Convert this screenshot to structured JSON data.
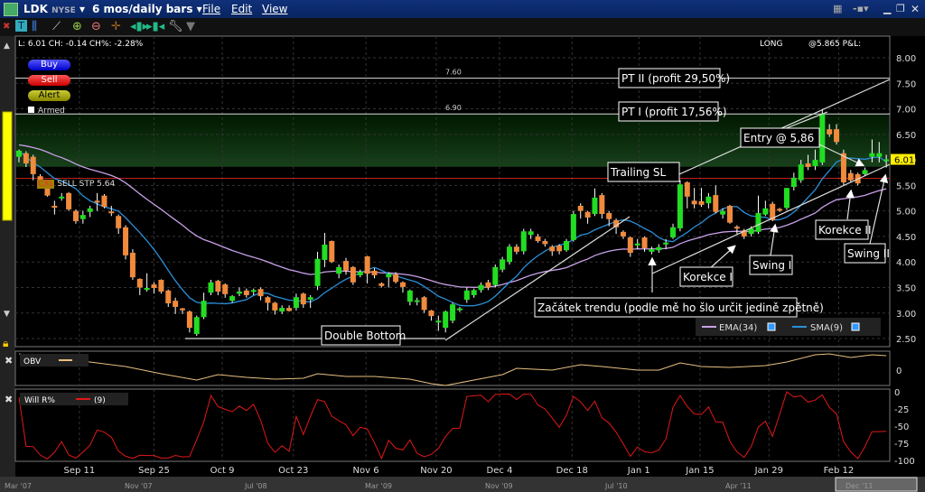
{
  "window": {
    "symbol": "LDK",
    "exchange": "NYSE",
    "period": "6 mos/daily bars",
    "menu": [
      "File",
      "Edit",
      "View"
    ]
  },
  "info": {
    "quote": "L: 6.01 CH: -0.14 CH%: -2.28%",
    "position": "LONG",
    "pnl": "@5.865 P&L:"
  },
  "order_buttons": {
    "buy": "Buy",
    "sell": "Sell",
    "alert": "Alert",
    "armed": "Armed"
  },
  "order_tag": {
    "cancel": "CXL",
    "text": "SELL STP 5.64"
  },
  "colors": {
    "up": "#22dd22",
    "down": "#f08a3c",
    "ema": "#c8a0e8",
    "sma": "#2a8fd8",
    "obv": "#e8c080",
    "willr": "#e01818",
    "stop": "#c02020",
    "last": "#ffee00"
  },
  "chart_data": [
    {
      "type": "candlestick",
      "ylim": [
        2.35,
        8.25
      ],
      "y_ticks": [
        "8.00",
        "7.50",
        "7.00",
        "6.50",
        "6.00",
        "5.50",
        "5.00",
        "4.50",
        "4.00",
        "3.50",
        "3.00",
        "2.50"
      ],
      "last_price": "6.01",
      "x_labels": [
        {
          "label": "Sep 11",
          "bar": 8.5
        },
        {
          "label": "Sep 25",
          "bar": 19
        },
        {
          "label": "Oct 9",
          "bar": 28.6
        },
        {
          "label": "Oct 23",
          "bar": 38.6
        },
        {
          "label": "Nov 6",
          "bar": 48.8
        },
        {
          "label": "Nov 20",
          "bar": 58.7
        },
        {
          "label": "Dec 4",
          "bar": 67.6
        },
        {
          "label": "Dec 18",
          "bar": 77.8
        },
        {
          "label": "Jan 1",
          "bar": 87.2
        },
        {
          "label": "Jan 15",
          "bar": 95.8
        },
        {
          "label": "Jan 29",
          "bar": 105.5
        },
        {
          "label": "Feb 12",
          "bar": 115.3
        }
      ],
      "ohlc": [
        [
          6.06,
          6.2,
          5.95,
          6.18
        ],
        [
          6.13,
          6.17,
          5.86,
          5.93
        ],
        [
          6.06,
          6.1,
          5.6,
          5.72
        ],
        [
          5.68,
          5.72,
          5.55,
          5.6
        ],
        [
          5.5,
          5.55,
          5.28,
          5.3
        ],
        [
          5.1,
          5.2,
          4.93,
          5.08
        ],
        [
          5.25,
          5.35,
          5.2,
          5.28
        ],
        [
          5.35,
          5.37,
          5.0,
          5.03
        ],
        [
          5.0,
          5.03,
          4.75,
          4.8
        ],
        [
          4.84,
          5.0,
          4.75,
          4.92
        ],
        [
          4.98,
          5.1,
          4.88,
          5.05
        ],
        [
          5.2,
          5.35,
          5.0,
          5.18
        ],
        [
          5.3,
          5.33,
          5.05,
          5.08
        ],
        [
          4.99,
          5.1,
          4.9,
          4.96
        ],
        [
          4.9,
          4.93,
          4.55,
          4.66
        ],
        [
          4.68,
          4.72,
          4.05,
          4.13
        ],
        [
          4.18,
          4.25,
          3.65,
          3.7
        ],
        [
          3.67,
          3.68,
          3.35,
          3.5
        ],
        [
          3.47,
          3.78,
          3.42,
          3.49
        ],
        [
          3.56,
          3.6,
          3.38,
          3.49
        ],
        [
          3.65,
          3.66,
          3.38,
          3.42
        ],
        [
          3.44,
          3.46,
          3.12,
          3.19
        ],
        [
          3.24,
          3.3,
          2.98,
          3.12
        ],
        [
          3.09,
          3.1,
          2.98,
          3.07
        ],
        [
          3.03,
          3.05,
          2.62,
          2.71
        ],
        [
          2.59,
          2.95,
          2.55,
          2.92
        ],
        [
          2.92,
          3.4,
          2.88,
          3.24
        ],
        [
          3.4,
          3.65,
          3.35,
          3.6
        ],
        [
          3.63,
          3.65,
          3.35,
          3.42
        ],
        [
          3.56,
          3.58,
          3.3,
          3.37
        ],
        [
          3.24,
          3.35,
          3.2,
          3.33
        ],
        [
          3.38,
          3.5,
          3.33,
          3.42
        ],
        [
          3.44,
          3.48,
          3.3,
          3.35
        ],
        [
          3.42,
          3.48,
          3.35,
          3.45
        ],
        [
          3.47,
          3.5,
          3.25,
          3.33
        ],
        [
          3.31,
          3.33,
          3.05,
          3.2
        ],
        [
          3.2,
          3.22,
          2.97,
          3.05
        ],
        [
          3.03,
          3.15,
          2.98,
          3.1
        ],
        [
          3.1,
          3.15,
          3.03,
          3.04
        ],
        [
          3.1,
          3.38,
          3.05,
          3.31
        ],
        [
          3.38,
          3.4,
          3.1,
          3.17
        ],
        [
          3.26,
          3.35,
          3.1,
          3.31
        ],
        [
          3.53,
          4.2,
          3.45,
          4.06
        ],
        [
          4.04,
          4.57,
          3.9,
          4.34
        ],
        [
          4.41,
          4.42,
          3.98,
          4.0
        ],
        [
          3.77,
          3.95,
          3.68,
          3.9
        ],
        [
          4.02,
          4.08,
          3.75,
          3.83
        ],
        [
          3.9,
          3.92,
          3.55,
          3.6
        ],
        [
          3.74,
          3.85,
          3.7,
          3.81
        ],
        [
          4.11,
          4.12,
          3.58,
          3.77
        ],
        [
          3.83,
          3.88,
          3.68,
          3.74
        ],
        [
          3.58,
          3.6,
          3.5,
          3.53
        ],
        [
          3.7,
          3.8,
          3.5,
          3.77
        ],
        [
          3.76,
          3.8,
          3.58,
          3.61
        ],
        [
          3.6,
          3.62,
          3.4,
          3.51
        ],
        [
          3.22,
          3.46,
          3.15,
          3.44
        ],
        [
          3.23,
          3.3,
          3.15,
          3.25
        ],
        [
          3.31,
          3.33,
          3.0,
          3.06
        ],
        [
          3.05,
          3.06,
          2.85,
          2.94
        ],
        [
          2.83,
          2.95,
          2.65,
          2.85
        ],
        [
          2.71,
          3.05,
          2.62,
          3.03
        ],
        [
          2.85,
          3.2,
          2.8,
          3.17
        ],
        [
          3.07,
          3.12,
          3.02,
          3.09
        ],
        [
          3.26,
          3.5,
          3.2,
          3.44
        ],
        [
          3.35,
          3.48,
          3.3,
          3.45
        ],
        [
          3.45,
          3.6,
          3.4,
          3.55
        ],
        [
          3.6,
          3.65,
          3.45,
          3.5
        ],
        [
          3.55,
          3.95,
          3.5,
          3.9
        ],
        [
          3.85,
          4.1,
          3.8,
          4.05
        ],
        [
          4.0,
          4.35,
          3.95,
          4.3
        ],
        [
          4.3,
          4.35,
          4.15,
          4.2
        ],
        [
          4.21,
          4.65,
          4.15,
          4.6
        ],
        [
          4.53,
          4.65,
          4.45,
          4.6
        ],
        [
          4.5,
          4.55,
          4.38,
          4.41
        ],
        [
          4.41,
          4.45,
          4.3,
          4.35
        ],
        [
          4.3,
          4.33,
          4.12,
          4.21
        ],
        [
          4.32,
          4.35,
          4.15,
          4.21
        ],
        [
          4.23,
          4.45,
          4.2,
          4.41
        ],
        [
          4.43,
          5.0,
          4.4,
          4.94
        ],
        [
          5.1,
          5.15,
          4.85,
          5.0
        ],
        [
          4.98,
          5.0,
          4.75,
          4.87
        ],
        [
          4.94,
          5.44,
          4.9,
          5.26
        ],
        [
          5.31,
          5.35,
          4.85,
          4.94
        ],
        [
          4.96,
          5.0,
          4.7,
          4.84
        ],
        [
          4.82,
          4.85,
          4.55,
          4.68
        ],
        [
          4.59,
          4.62,
          4.45,
          4.5
        ],
        [
          4.48,
          4.5,
          4.1,
          4.18
        ],
        [
          4.36,
          4.45,
          4.25,
          4.36
        ],
        [
          4.48,
          4.5,
          4.2,
          4.27
        ],
        [
          4.2,
          4.3,
          4.15,
          4.25
        ],
        [
          4.23,
          4.35,
          4.18,
          4.29
        ],
        [
          4.36,
          4.45,
          4.25,
          4.38
        ],
        [
          4.48,
          4.75,
          4.45,
          4.68
        ],
        [
          4.66,
          5.6,
          4.6,
          5.52
        ],
        [
          5.56,
          5.58,
          5.05,
          5.28
        ],
        [
          5.2,
          5.45,
          5.05,
          5.13
        ],
        [
          5.19,
          5.45,
          5.08,
          5.12
        ],
        [
          5.15,
          5.35,
          5.05,
          5.28
        ],
        [
          5.31,
          5.5,
          4.95,
          4.98
        ],
        [
          4.93,
          5.05,
          4.85,
          5.0
        ],
        [
          5.1,
          5.12,
          4.75,
          4.77
        ],
        [
          4.69,
          4.72,
          4.55,
          4.68
        ],
        [
          4.62,
          4.65,
          4.45,
          4.5
        ],
        [
          4.55,
          4.7,
          4.5,
          4.66
        ],
        [
          4.59,
          5.3,
          4.55,
          4.96
        ],
        [
          4.93,
          5.2,
          4.9,
          5.05
        ],
        [
          5.14,
          5.18,
          4.8,
          4.82
        ],
        [
          5.04,
          5.06,
          4.98,
          5.02
        ],
        [
          5.06,
          5.45,
          5.02,
          5.45
        ],
        [
          5.47,
          5.75,
          5.4,
          5.65
        ],
        [
          5.6,
          6.0,
          5.55,
          5.91
        ],
        [
          5.93,
          6.1,
          5.8,
          5.86
        ],
        [
          5.88,
          6.2,
          5.8,
          6.0
        ],
        [
          5.95,
          7.0,
          5.9,
          6.9
        ],
        [
          6.6,
          6.7,
          6.45,
          6.5
        ],
        [
          6.6,
          6.7,
          6.3,
          6.35
        ],
        [
          6.13,
          6.2,
          5.5,
          5.56
        ],
        [
          5.74,
          5.8,
          5.55,
          5.6
        ],
        [
          5.72,
          5.75,
          5.5,
          5.54
        ],
        [
          5.72,
          5.85,
          5.68,
          5.8
        ],
        [
          6.06,
          6.4,
          5.95,
          6.13
        ],
        [
          6.06,
          6.35,
          5.95,
          6.13
        ],
        [
          6.0,
          6.1,
          5.85,
          6.01
        ]
      ],
      "indicators": [
        "EMA(34)",
        "SMA(9)"
      ],
      "levels": [
        {
          "label": "7.60",
          "price": 7.6
        },
        {
          "label": "6.90",
          "price": 6.9
        }
      ],
      "stop_price": 5.64,
      "entry_price": 5.865,
      "annotations": {
        "pt2": "PT II (profit 29,50%)",
        "pt1": "PT I (profit 17,56%)",
        "entry": "Entry @ 5,86",
        "trailing": "Trailing SL",
        "double_bottom": "Double Bottom",
        "trend_start": "Začátek trendu (podle mě ho šlo určit jedině zpětně)",
        "korekce1": "Korekce I",
        "swing1": "Swing I",
        "korekce2": "Korekce II",
        "swing2": "Swing II"
      }
    },
    {
      "type": "line",
      "name": "OBV",
      "y_ticks": [
        "0"
      ],
      "points": [
        [
          0,
          19
        ],
        [
          5,
          13
        ],
        [
          10,
          10
        ],
        [
          15,
          5
        ],
        [
          20,
          -3
        ],
        [
          25,
          -10
        ],
        [
          28,
          -4
        ],
        [
          32,
          -7
        ],
        [
          36,
          -9
        ],
        [
          40,
          -8
        ],
        [
          42,
          -3
        ],
        [
          46,
          -6
        ],
        [
          50,
          -6
        ],
        [
          55,
          -9
        ],
        [
          58,
          -14
        ],
        [
          60,
          -16
        ],
        [
          64,
          -10
        ],
        [
          68,
          -4
        ],
        [
          70,
          3
        ],
        [
          75,
          1
        ],
        [
          79,
          7
        ],
        [
          82,
          5
        ],
        [
          87,
          1
        ],
        [
          90,
          1
        ],
        [
          93,
          9
        ],
        [
          96,
          5
        ],
        [
          100,
          4
        ],
        [
          105,
          6
        ],
        [
          108,
          10
        ],
        [
          112,
          18
        ],
        [
          114,
          19
        ],
        [
          117,
          15
        ],
        [
          120,
          18
        ],
        [
          122,
          17
        ]
      ]
    },
    {
      "type": "line",
      "name": "Will R%",
      "period": "(9)",
      "ylim": [
        -100,
        0
      ],
      "y_ticks": [
        "0",
        "-25",
        "-50",
        "-75",
        "-100"
      ]
    }
  ],
  "timeline": [
    "Mar '07",
    "Nov '07",
    "Jul '08",
    "Mar '09",
    "Nov '09",
    "Jul '10",
    "Apr '11",
    "Dec '11"
  ]
}
